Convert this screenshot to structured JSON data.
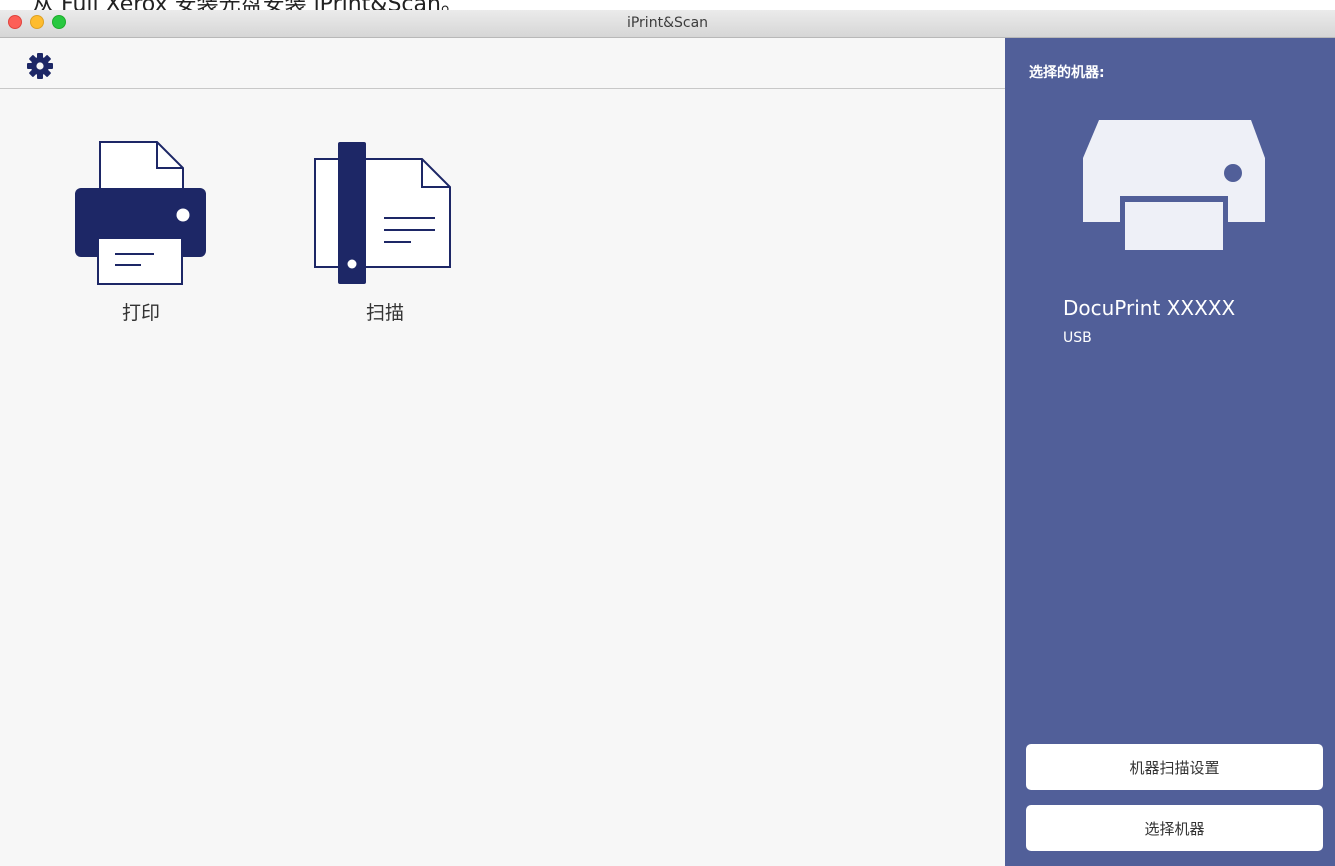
{
  "caption": "从 Fuji Xerox 安装光盘安装 iPrint&Scan。",
  "window": {
    "title": "iPrint&Scan",
    "controls": [
      "close",
      "minimize",
      "maximize"
    ]
  },
  "toolbar": {
    "settings_icon": "gear-icon"
  },
  "functions": [
    {
      "label": "打印",
      "icon": "printer-icon"
    },
    {
      "label": "扫描",
      "icon": "scanner-icon"
    }
  ],
  "sidebar": {
    "heading": "选择的机器:",
    "device": {
      "name": "DocuPrint XXXXX",
      "connection": "USB",
      "icon": "printer-icon"
    },
    "buttons": {
      "scan_settings": "机器扫描设置",
      "select_device": "选择机器"
    }
  },
  "colors": {
    "sidebar_bg": "#515f99",
    "icon_navy": "#1d2766",
    "main_bg": "#f7f7f7"
  }
}
